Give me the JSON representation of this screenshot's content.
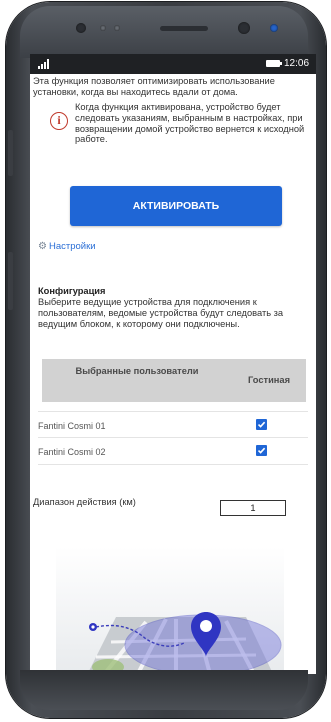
{
  "status_bar": {
    "time": "12:06"
  },
  "intro_text": "Эта функция позволяет оптимизировать использование установки, когда вы находитесь вдали от дома.",
  "info_note": "Когда функция активирована, устройство будет следовать указаниям, выбранным в настройках, при возвращении домой устройство вернется к исходной работе.",
  "activate_button": "АКТИВИРОВАТЬ",
  "settings_link": "Настройки",
  "configuration": {
    "title": "Конфигурация",
    "description": "Выберите ведущие устройства для подключения к пользователям, ведомые устройства будут следовать за ведущим блоком, к которому они подключены."
  },
  "table": {
    "headers": [
      "Выбранные пользователи",
      "Гостиная"
    ],
    "rows": [
      {
        "name": "Fantini Cosmi 01",
        "checked": true
      },
      {
        "name": "Fantini Cosmi 02",
        "checked": true
      }
    ]
  },
  "range": {
    "label": "Диапазон действия (км)",
    "value": "1"
  },
  "colors": {
    "accent": "#1f66d6",
    "info_icon": "#c0392b",
    "map_circle": "#6f71d8"
  },
  "icons": [
    "signal-icon",
    "battery-icon",
    "info-icon",
    "gear-icon",
    "checkbox-checked-icon",
    "location-pin-icon"
  ]
}
